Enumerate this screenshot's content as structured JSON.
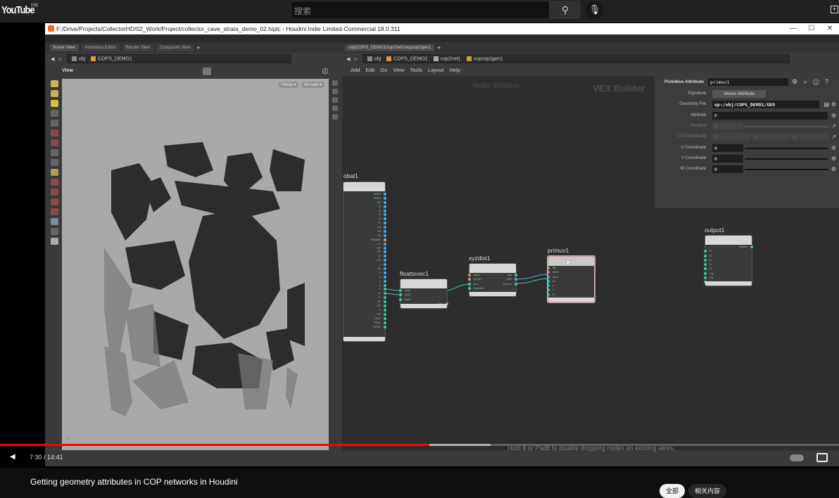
{
  "youtube": {
    "logo": "YouTube",
    "region": "HK",
    "search_placeholder": "搜索",
    "search_icon": "search-icon",
    "mic_icon": "mic-icon",
    "create_icon": "create-icon"
  },
  "window": {
    "title": "F:/Drive/Projects/CollectorHD/02_Work/Project/collector_cave_strata_demo_02.hiplc - Houdini Indie Limited-Commercial 18.0.311",
    "minimize": "—",
    "maximize": "☐",
    "close": "✕"
  },
  "left_pane": {
    "tabs": [
      "Scene View",
      "Animation Editor",
      "Render View",
      "Composite View"
    ],
    "path": [
      "obj",
      "COPS_DEMO1"
    ],
    "view_label": "View",
    "persp": "Persp ▾",
    "cam": "No cam ▾"
  },
  "right_pane": {
    "tab": "/obj/COPS_DEMO1/cop2net1/vopcop2gen1",
    "path": [
      "obj",
      "COPS_DEMO1",
      "cop2net1",
      "vopcop2gen1"
    ],
    "menu": [
      "Add",
      "Edit",
      "Go",
      "View",
      "Tools",
      "Layout",
      "Help"
    ],
    "watermark_edition": "Indie Edition",
    "watermark_context": "VEX Builder"
  },
  "parameters": {
    "node_type": "Primitive Attribute",
    "node_name": "primuv1",
    "rows": [
      {
        "label": "Signature",
        "value": "Vector Attribute"
      },
      {
        "label": "Geometry File",
        "value": "op:/obj/COPS_DEMO1/GEO"
      },
      {
        "label": "Attribute",
        "value": "P"
      },
      {
        "label": "Primitive",
        "value": "0"
      },
      {
        "label": "UV Coordinate",
        "value": "0",
        "value2": "0",
        "value3": "0"
      },
      {
        "label": "U Coordinate",
        "value": "0"
      },
      {
        "label": "V Coordinate",
        "value": "0"
      },
      {
        "label": "W Coordinate",
        "value": "0"
      }
    ]
  },
  "nodes": {
    "global": {
      "name": "obal1",
      "outputs": [
        "XRES",
        "YRES",
        "AR",
        "R",
        "G",
        "B",
        "A",
        "Cr",
        "Cg",
        "Cb",
        "C4",
        "PNAME",
        "PL",
        "NP",
        "PS",
        "AI",
        "AO",
        "I",
        "NI",
        "H",
        "S",
        "V",
        "X",
        "Y",
        "IX",
        "IY",
        "SF",
        "EF",
        "F",
        "FR",
        "TINC",
        "FINC",
        "PXSC"
      ]
    },
    "floattovec": {
      "name": "floattovec1",
      "inputs": [
        "fval1",
        "fval2",
        "fval3"
      ],
      "outputs": [
        "vec"
      ]
    },
    "xyzdist": {
      "name": "xyzdist1",
      "inputs": [
        "input",
        "group",
        "pos",
        "maxdist"
      ],
      "outputs": [
        "dist",
        "prim",
        "primuv"
      ]
    },
    "primuv": {
      "name": "primuv1",
      "inputs": [
        "file",
        "attrib",
        "prim",
        "uv",
        "u",
        "v",
        "w"
      ],
      "outputs": [
        "adata"
      ]
    },
    "output": {
      "name": "output1",
      "inputs": [
        "R",
        "G",
        "B",
        "A",
        "Cr",
        "Cg",
        "Cb",
        "C4"
      ],
      "outputs": [
        "shader"
      ]
    }
  },
  "status_message": "Hold 8 or Pad8 to disable dropping nodes on existing wires.",
  "player": {
    "current": "7:30",
    "duration": "14:41",
    "time_display": "7:30 / 14:41",
    "progress": 0.512,
    "buffered": 0.585
  },
  "video_title": "Getting geometry attributes in COP networks in Houdini",
  "chips": [
    "全部",
    "相关内容"
  ],
  "colors": {
    "progress": "#ff0000",
    "wire": "#3ec6a6",
    "selected_wire": "#4aa8e8"
  }
}
